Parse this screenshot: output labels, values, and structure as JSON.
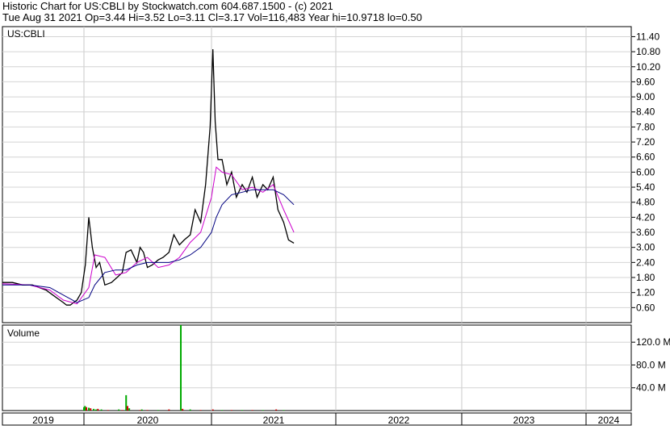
{
  "header": {
    "title_line": "Historic Chart for US:CBLI by Stockwatch.com 604.687.1500 - (c) 2021",
    "quote_line": "Tue Aug 31 2021  Op=3.44  Hi=3.52  Lo=3.11  Cl=3.17  Vol=116,483  Year hi=10.9718  lo=0.50"
  },
  "chart_data": [
    {
      "type": "line",
      "title": "US:CBLI",
      "y_scale": "linear",
      "ylim": [
        0,
        11.8
      ],
      "y_ticks": [
        "0.60",
        "1.20",
        "1.80",
        "2.40",
        "3.00",
        "3.60",
        "4.20",
        "4.80",
        "5.40",
        "6.00",
        "6.60",
        "7.20",
        "7.80",
        "8.40",
        "9.00",
        "9.60",
        "10.20",
        "10.80",
        "11.40"
      ],
      "x_labels": [
        "2019",
        "2020",
        "2021",
        "2022",
        "2023",
        "2024"
      ],
      "grid": true,
      "series": [
        {
          "name": "",
          "color": "#000000",
          "x": [
            "2019-01-01",
            "2019-02-15",
            "2019-04-01",
            "2019-05-15",
            "2019-06-15",
            "2019-07-15",
            "2019-08-15",
            "2019-09-15",
            "2019-10-01",
            "2019-10-15",
            "2019-11-01",
            "2019-11-15",
            "2019-12-01",
            "2019-12-20",
            "2020-01-05",
            "2020-01-15",
            "2020-01-25",
            "2020-02-05",
            "2020-02-15",
            "2020-03-01",
            "2020-03-20",
            "2020-04-05",
            "2020-04-20",
            "2020-05-01",
            "2020-05-15",
            "2020-06-01",
            "2020-06-10",
            "2020-06-20",
            "2020-07-01",
            "2020-07-15",
            "2020-08-01",
            "2020-08-15",
            "2020-09-01",
            "2020-09-15",
            "2020-10-01",
            "2020-10-15",
            "2020-11-01",
            "2020-11-15",
            "2020-12-01",
            "2020-12-15",
            "2020-12-28",
            "2021-01-05",
            "2021-01-12",
            "2021-01-20",
            "2021-02-01",
            "2021-02-15",
            "2021-03-01",
            "2021-03-15",
            "2021-04-01",
            "2021-04-15",
            "2021-05-01",
            "2021-05-15",
            "2021-06-01",
            "2021-06-15",
            "2021-07-01",
            "2021-07-15",
            "2021-08-01",
            "2021-08-15",
            "2021-08-31"
          ],
          "values": [
            1.6,
            1.6,
            1.5,
            1.5,
            1.4,
            1.3,
            1.1,
            0.9,
            0.8,
            0.7,
            0.7,
            0.8,
            0.9,
            1.2,
            2.3,
            4.2,
            3.0,
            2.2,
            2.4,
            1.5,
            1.6,
            1.8,
            2.0,
            2.8,
            2.9,
            2.4,
            3.0,
            2.8,
            2.2,
            2.3,
            2.5,
            2.6,
            2.8,
            3.5,
            3.1,
            3.3,
            3.5,
            4.5,
            4.0,
            5.5,
            7.8,
            10.9,
            8.0,
            6.5,
            6.5,
            5.5,
            6.0,
            5.0,
            5.5,
            5.2,
            5.8,
            5.0,
            5.5,
            5.3,
            5.8,
            4.5,
            4.0,
            3.3,
            3.17
          ]
        },
        {
          "name": "",
          "color": "#cc00cc",
          "x": [
            "2019-01-01",
            "2019-05-01",
            "2019-08-01",
            "2019-10-01",
            "2019-12-01",
            "2020-01-15",
            "2020-02-01",
            "2020-03-01",
            "2020-04-01",
            "2020-05-01",
            "2020-06-01",
            "2020-07-01",
            "2020-08-01",
            "2020-09-01",
            "2020-10-01",
            "2020-11-01",
            "2020-12-01",
            "2021-01-01",
            "2021-01-15",
            "2021-02-01",
            "2021-03-01",
            "2021-04-01",
            "2021-05-01",
            "2021-06-01",
            "2021-07-01",
            "2021-08-01",
            "2021-08-31"
          ],
          "values": [
            1.55,
            1.5,
            1.3,
            0.9,
            0.75,
            1.4,
            2.7,
            2.6,
            1.9,
            2.0,
            2.4,
            2.6,
            2.2,
            2.3,
            2.6,
            3.2,
            3.6,
            5.0,
            6.2,
            6.0,
            5.9,
            5.3,
            5.4,
            5.2,
            5.5,
            4.5,
            3.6
          ]
        },
        {
          "name": "",
          "color": "#000080",
          "x": [
            "2019-01-01",
            "2019-05-01",
            "2019-08-01",
            "2019-10-01",
            "2019-12-01",
            "2020-01-15",
            "2020-02-01",
            "2020-03-01",
            "2020-04-01",
            "2020-05-01",
            "2020-06-01",
            "2020-07-01",
            "2020-08-01",
            "2020-09-01",
            "2020-10-01",
            "2020-11-01",
            "2020-12-01",
            "2021-01-01",
            "2021-01-15",
            "2021-02-01",
            "2021-03-01",
            "2021-04-01",
            "2021-05-01",
            "2021-06-01",
            "2021-07-01",
            "2021-08-01",
            "2021-08-31"
          ],
          "values": [
            1.5,
            1.5,
            1.4,
            1.1,
            0.8,
            1.0,
            1.5,
            2.0,
            2.1,
            2.1,
            2.3,
            2.4,
            2.4,
            2.4,
            2.5,
            2.7,
            3.0,
            3.6,
            4.2,
            4.7,
            5.1,
            5.2,
            5.3,
            5.3,
            5.3,
            5.1,
            4.7
          ]
        }
      ]
    },
    {
      "type": "bar",
      "title": "Volume",
      "ylim": [
        0,
        150
      ],
      "y_ticks": [
        "40.0 M",
        "80.0 M",
        "120.0 M"
      ],
      "x": [
        "2020-01-01",
        "2020-01-04",
        "2020-01-08",
        "2020-01-15",
        "2020-01-20",
        "2020-01-29",
        "2020-02-05",
        "2020-02-10",
        "2020-02-20",
        "2020-03-10",
        "2020-04-10",
        "2020-04-20",
        "2020-05-01",
        "2020-05-05",
        "2020-05-10",
        "2020-06-10",
        "2020-06-15",
        "2020-07-01",
        "2020-08-01",
        "2020-09-01",
        "2020-10-05",
        "2020-10-10",
        "2020-11-01",
        "2020-12-01",
        "2021-01-05",
        "2021-02-01",
        "2021-03-01",
        "2021-04-01",
        "2021-05-01",
        "2021-06-01",
        "2021-07-10",
        "2021-08-01"
      ],
      "values": [
        6,
        8,
        6,
        5,
        4,
        3,
        2,
        3,
        2,
        1,
        2,
        1,
        27,
        8,
        4,
        1,
        2,
        1,
        1,
        2,
        150,
        3,
        2,
        1,
        2,
        1,
        1,
        1,
        1,
        1,
        2,
        1
      ],
      "colors": [
        "#00aa00",
        "#00aa00",
        "#cc0000",
        "#00aa00",
        "#cc0000",
        "#00aa00",
        "#00aa00",
        "#cc0000",
        "#00aa00",
        "#cc0000",
        "#00aa00",
        "#cc0000",
        "#00aa00",
        "#cc0000",
        "#00aa00",
        "#cc0000",
        "#00aa00",
        "#cc0000",
        "#00aa00",
        "#cc0000",
        "#00aa00",
        "#cc0000",
        "#00aa00",
        "#cc0000",
        "#cc0000",
        "#00aa00",
        "#cc0000",
        "#00aa00",
        "#cc0000",
        "#00aa00",
        "#cc0000",
        "#00aa00"
      ]
    }
  ]
}
